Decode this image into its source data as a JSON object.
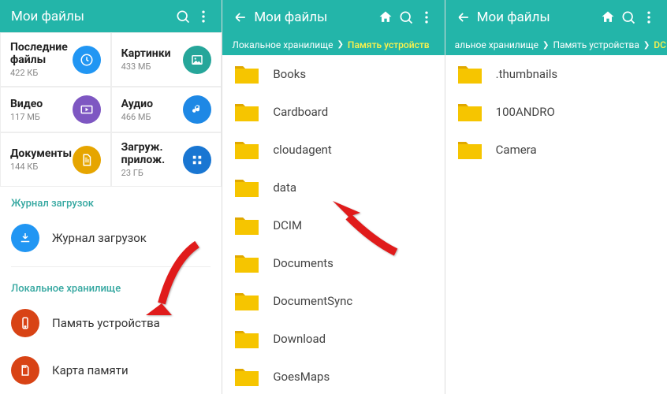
{
  "colors": {
    "accent": "#23b5a9",
    "arrow": "#e01b1b",
    "blue": "#2196f3",
    "green": "#26a69a",
    "purple": "#7e57c2",
    "cyan": "#00bcd4",
    "gold": "#e6a500",
    "dblue": "#1565c0",
    "red": "#d84315",
    "amber": "#ffb300"
  },
  "pane1": {
    "title": "Мои файлы",
    "tiles": [
      {
        "label": "Последние файлы",
        "sub": "422 КБ",
        "icon": "clock",
        "color": "#2196f3"
      },
      {
        "label": "Картинки",
        "sub": "433 МБ",
        "icon": "image",
        "color": "#26a69a"
      },
      {
        "label": "Видео",
        "sub": "117 МБ",
        "icon": "video",
        "color": "#7e57c2"
      },
      {
        "label": "Аудио",
        "sub": "466 МБ",
        "icon": "audio",
        "color": "#1e88e5"
      },
      {
        "label": "Документы",
        "sub": "144 КБ",
        "icon": "doc",
        "color": "#e6a500"
      },
      {
        "label": "Загруж. прилож.",
        "sub": "23 ГБ",
        "icon": "apps",
        "color": "#1976d2"
      }
    ],
    "section_downloads": "Журнал загрузок",
    "download_journal": "Журнал загрузок",
    "section_storage": "Локальное хранилище",
    "storage_device": "Память устройства",
    "sd_card": "Карта памяти"
  },
  "pane2": {
    "title": "Мои файлы",
    "crumb1": "Локальное хранилище",
    "crumb2": "Память устройств",
    "folders": [
      "Books",
      "Cardboard",
      "cloudagent",
      "data",
      "DCIM",
      "Documents",
      "DocumentSync",
      "Download",
      "GoesMaps"
    ]
  },
  "pane3": {
    "title": "Мои файлы",
    "crumb1": "альное хранилище",
    "crumb2": "Память устройства",
    "crumb3": "DCII",
    "folders": [
      ".thumbnails",
      "100ANDRO",
      "Camera"
    ]
  }
}
